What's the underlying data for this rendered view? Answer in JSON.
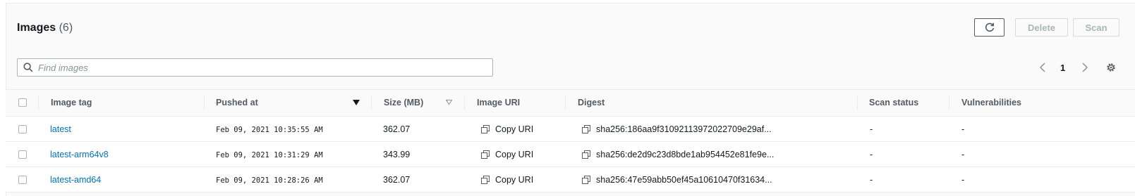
{
  "header": {
    "title": "Images",
    "count": "(6)"
  },
  "actions": {
    "refresh_icon": "refresh-icon",
    "delete_label": "Delete",
    "scan_label": "Scan"
  },
  "search": {
    "placeholder": "Find images",
    "value": ""
  },
  "pagination": {
    "current_page": "1"
  },
  "table": {
    "columns": [
      "Image tag",
      "Pushed at",
      "Size (MB)",
      "Image URI",
      "Digest",
      "Scan status",
      "Vulnerabilities"
    ],
    "sort": {
      "column": "Pushed at",
      "direction": "descending"
    },
    "rows": [
      {
        "tag": "latest",
        "pushed_at": "Feb 09, 2021 10:35:55 AM",
        "size": "362.07",
        "uri": "Copy URI",
        "digest": "sha256:186aa9f31092113972022709e29af...",
        "scan_status": "-",
        "vulnerabilities": "-"
      },
      {
        "tag": "latest-arm64v8",
        "pushed_at": "Feb 09, 2021 10:31:29 AM",
        "size": "343.99",
        "uri": "Copy URI",
        "digest": "sha256:de2d9c23d8bde1ab954452e81fe9e...",
        "scan_status": "-",
        "vulnerabilities": "-"
      },
      {
        "tag": "latest-amd64",
        "pushed_at": "Feb 09, 2021 10:28:26 AM",
        "size": "362.07",
        "uri": "Copy URI",
        "digest": "sha256:47e59abb50ef45a10610470f31634...",
        "scan_status": "-",
        "vulnerabilities": "-"
      }
    ]
  },
  "colors": {
    "link": "#0073bb",
    "text": "#16191f",
    "muted": "#545b64",
    "border": "#eaeded"
  }
}
